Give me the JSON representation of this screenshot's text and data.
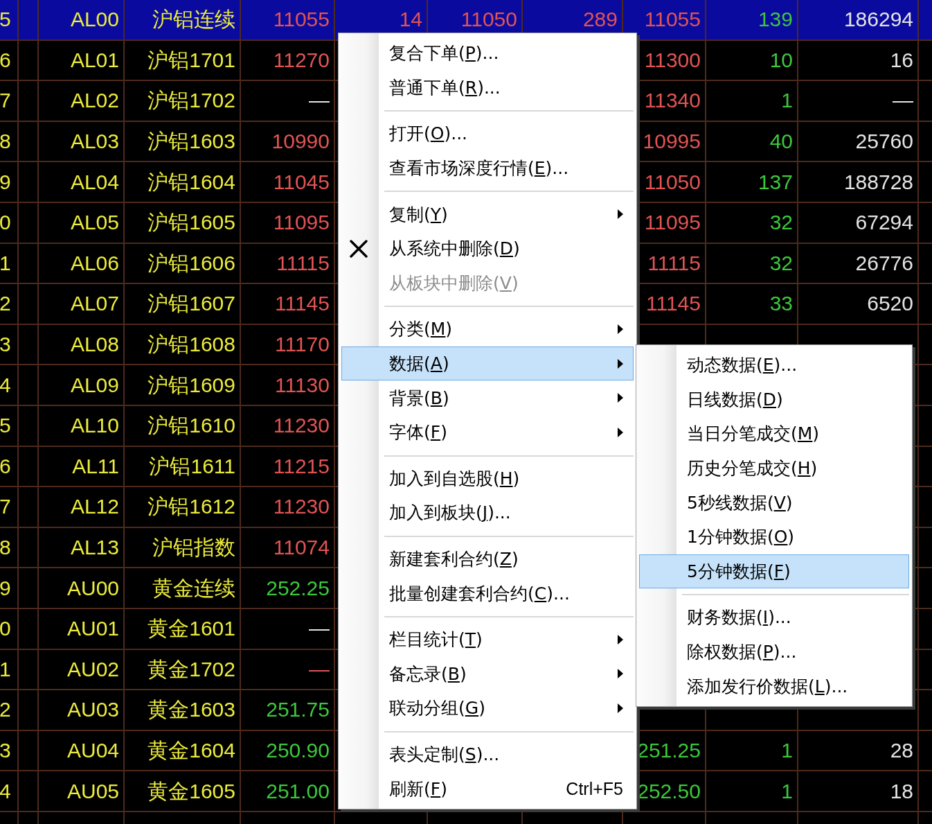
{
  "table": {
    "rows": [
      {
        "selected": true,
        "column_1": {
          "text": "5",
          "kind": "label"
        },
        "column_3": {
          "text": "AL00",
          "kind": "label"
        },
        "column_4": {
          "text": "沪铝连续",
          "kind": "label"
        },
        "column_5": {
          "text": "11055",
          "kind": "up"
        },
        "column_6": {
          "text": "14",
          "kind": "up"
        },
        "column_7": {
          "text": "11050",
          "kind": "up"
        },
        "column_8": {
          "text": "289",
          "kind": "up"
        },
        "column_9": {
          "text": "11055",
          "kind": "up"
        },
        "column_10": {
          "text": "139",
          "kind": "down"
        },
        "column_11": {
          "text": "186294",
          "kind": "flat"
        }
      },
      {
        "selected": false,
        "column_1": {
          "text": "6",
          "kind": "label"
        },
        "column_3": {
          "text": "AL01",
          "kind": "label"
        },
        "column_4": {
          "text": "沪铝1701",
          "kind": "label"
        },
        "column_5": {
          "text": "11270",
          "kind": "up"
        },
        "column_9": {
          "text": "11300",
          "kind": "up"
        },
        "column_10": {
          "text": "10",
          "kind": "down"
        },
        "column_11": {
          "text": "16",
          "kind": "flat"
        }
      },
      {
        "selected": false,
        "column_1": {
          "text": "7",
          "kind": "label"
        },
        "column_3": {
          "text": "AL02",
          "kind": "label"
        },
        "column_4": {
          "text": "沪铝1702",
          "kind": "label"
        },
        "column_5": {
          "text": "—",
          "kind": "flat"
        },
        "column_9": {
          "text": "11340",
          "kind": "up"
        },
        "column_10": {
          "text": "1",
          "kind": "down"
        },
        "column_11": {
          "text": "—",
          "kind": "flat"
        }
      },
      {
        "selected": false,
        "column_1": {
          "text": "8",
          "kind": "label"
        },
        "column_3": {
          "text": "AL03",
          "kind": "label"
        },
        "column_4": {
          "text": "沪铝1603",
          "kind": "label"
        },
        "column_5": {
          "text": "10990",
          "kind": "up"
        },
        "column_9": {
          "text": "10995",
          "kind": "up"
        },
        "column_10": {
          "text": "40",
          "kind": "down"
        },
        "column_11": {
          "text": "25760",
          "kind": "flat"
        }
      },
      {
        "selected": false,
        "column_1": {
          "text": "9",
          "kind": "label"
        },
        "column_3": {
          "text": "AL04",
          "kind": "label"
        },
        "column_4": {
          "text": "沪铝1604",
          "kind": "label"
        },
        "column_5": {
          "text": "11045",
          "kind": "up"
        },
        "column_9": {
          "text": "11050",
          "kind": "up"
        },
        "column_10": {
          "text": "137",
          "kind": "down"
        },
        "column_11": {
          "text": "188728",
          "kind": "flat"
        }
      },
      {
        "selected": false,
        "column_1": {
          "text": "0",
          "kind": "label"
        },
        "column_3": {
          "text": "AL05",
          "kind": "label"
        },
        "column_4": {
          "text": "沪铝1605",
          "kind": "label"
        },
        "column_5": {
          "text": "11095",
          "kind": "up"
        },
        "column_9": {
          "text": "11095",
          "kind": "up"
        },
        "column_10": {
          "text": "32",
          "kind": "down"
        },
        "column_11": {
          "text": "67294",
          "kind": "flat"
        }
      },
      {
        "selected": false,
        "column_1": {
          "text": "1",
          "kind": "label"
        },
        "column_3": {
          "text": "AL06",
          "kind": "label"
        },
        "column_4": {
          "text": "沪铝1606",
          "kind": "label"
        },
        "column_5": {
          "text": "11115",
          "kind": "up"
        },
        "column_9": {
          "text": "11115",
          "kind": "up"
        },
        "column_10": {
          "text": "32",
          "kind": "down"
        },
        "column_11": {
          "text": "26776",
          "kind": "flat"
        }
      },
      {
        "selected": false,
        "column_1": {
          "text": "2",
          "kind": "label"
        },
        "column_3": {
          "text": "AL07",
          "kind": "label"
        },
        "column_4": {
          "text": "沪铝1607",
          "kind": "label"
        },
        "column_5": {
          "text": "11145",
          "kind": "up"
        },
        "column_9": {
          "text": "11145",
          "kind": "up"
        },
        "column_10": {
          "text": "33",
          "kind": "down"
        },
        "column_11": {
          "text": "6520",
          "kind": "flat"
        }
      },
      {
        "selected": false,
        "column_1": {
          "text": "3",
          "kind": "label"
        },
        "column_3": {
          "text": "AL08",
          "kind": "label"
        },
        "column_4": {
          "text": "沪铝1608",
          "kind": "label"
        },
        "column_5": {
          "text": "11170",
          "kind": "up"
        }
      },
      {
        "selected": false,
        "column_1": {
          "text": "4",
          "kind": "label"
        },
        "column_3": {
          "text": "AL09",
          "kind": "label"
        },
        "column_4": {
          "text": "沪铝1609",
          "kind": "label"
        },
        "column_5": {
          "text": "11130",
          "kind": "up"
        }
      },
      {
        "selected": false,
        "column_1": {
          "text": "5",
          "kind": "label"
        },
        "column_3": {
          "text": "AL10",
          "kind": "label"
        },
        "column_4": {
          "text": "沪铝1610",
          "kind": "label"
        },
        "column_5": {
          "text": "11230",
          "kind": "up"
        }
      },
      {
        "selected": false,
        "column_1": {
          "text": "6",
          "kind": "label"
        },
        "column_3": {
          "text": "AL11",
          "kind": "label"
        },
        "column_4": {
          "text": "沪铝1611",
          "kind": "label"
        },
        "column_5": {
          "text": "11215",
          "kind": "up"
        }
      },
      {
        "selected": false,
        "column_1": {
          "text": "7",
          "kind": "label"
        },
        "column_3": {
          "text": "AL12",
          "kind": "label"
        },
        "column_4": {
          "text": "沪铝1612",
          "kind": "label"
        },
        "column_5": {
          "text": "11230",
          "kind": "up"
        }
      },
      {
        "selected": false,
        "column_1": {
          "text": "8",
          "kind": "label"
        },
        "column_3": {
          "text": "AL13",
          "kind": "label"
        },
        "column_4": {
          "text": "沪铝指数",
          "kind": "label"
        },
        "column_5": {
          "text": "11074",
          "kind": "up"
        }
      },
      {
        "selected": false,
        "column_1": {
          "text": "9",
          "kind": "label"
        },
        "column_3": {
          "text": "AU00",
          "kind": "label"
        },
        "column_4": {
          "text": "黄金连续",
          "kind": "label"
        },
        "column_5": {
          "text": "252.25",
          "kind": "down"
        }
      },
      {
        "selected": false,
        "column_1": {
          "text": "0",
          "kind": "label"
        },
        "column_3": {
          "text": "AU01",
          "kind": "label"
        },
        "column_4": {
          "text": "黄金1601",
          "kind": "label"
        },
        "column_5": {
          "text": "—",
          "kind": "flat"
        }
      },
      {
        "selected": false,
        "column_1": {
          "text": "1",
          "kind": "label"
        },
        "column_3": {
          "text": "AU02",
          "kind": "label"
        },
        "column_4": {
          "text": "黄金1702",
          "kind": "label"
        },
        "column_5": {
          "text": "—",
          "kind": "up"
        }
      },
      {
        "selected": false,
        "column_1": {
          "text": "2",
          "kind": "label"
        },
        "column_3": {
          "text": "AU03",
          "kind": "label"
        },
        "column_4": {
          "text": "黄金1603",
          "kind": "label"
        },
        "column_5": {
          "text": "251.75",
          "kind": "down"
        }
      },
      {
        "selected": false,
        "column_1": {
          "text": "3",
          "kind": "label"
        },
        "column_3": {
          "text": "AU04",
          "kind": "label"
        },
        "column_4": {
          "text": "黄金1604",
          "kind": "label"
        },
        "column_5": {
          "text": "250.90",
          "kind": "down"
        },
        "column_9": {
          "text": "251.25",
          "kind": "down"
        },
        "column_10": {
          "text": "1",
          "kind": "down"
        },
        "column_11": {
          "text": "28",
          "kind": "flat"
        }
      },
      {
        "selected": false,
        "column_1": {
          "text": "4",
          "kind": "label"
        },
        "column_3": {
          "text": "AU05",
          "kind": "label"
        },
        "column_4": {
          "text": "黄金1605",
          "kind": "label"
        },
        "column_5": {
          "text": "251.00",
          "kind": "down"
        },
        "column_9": {
          "text": "252.50",
          "kind": "down"
        },
        "column_10": {
          "text": "1",
          "kind": "down"
        },
        "column_11": {
          "text": "18",
          "kind": "flat"
        }
      }
    ]
  },
  "context_menu": {
    "items": [
      {
        "kind": "item",
        "text": "复合下单(",
        "key": "P",
        "rest": ")...",
        "submenu": false,
        "disabled": false,
        "selected": false
      },
      {
        "kind": "item",
        "text": "普通下单(",
        "key": "R",
        "rest": ")...",
        "submenu": false,
        "disabled": false,
        "selected": false
      },
      {
        "kind": "separator"
      },
      {
        "kind": "item",
        "text": "打开(",
        "key": "O",
        "rest": ")...",
        "submenu": false,
        "disabled": false,
        "selected": false
      },
      {
        "kind": "item",
        "text": "查看市场深度行情(",
        "key": "E",
        "rest": ")...",
        "submenu": false,
        "disabled": false,
        "selected": false
      },
      {
        "kind": "separator"
      },
      {
        "kind": "item",
        "text": "复制(",
        "key": "Y",
        "rest": ")",
        "submenu": true,
        "disabled": false,
        "selected": false
      },
      {
        "kind": "delete",
        "text": "从系统中删除(",
        "key": "D",
        "rest": ")",
        "submenu": false,
        "disabled": false,
        "selected": false
      },
      {
        "kind": "item",
        "text": "从板块中删除(",
        "key": "V",
        "rest": ")",
        "submenu": false,
        "disabled": true,
        "selected": false
      },
      {
        "kind": "separator"
      },
      {
        "kind": "item",
        "text": "分类(",
        "key": "M",
        "rest": ")",
        "submenu": true,
        "disabled": false,
        "selected": false
      },
      {
        "kind": "item",
        "text": "数据(",
        "key": "A",
        "rest": ")",
        "submenu": true,
        "disabled": false,
        "selected": true
      },
      {
        "kind": "item",
        "text": "背景(",
        "key": "B",
        "rest": ")",
        "submenu": true,
        "disabled": false,
        "selected": false
      },
      {
        "kind": "item",
        "text": "字体(",
        "key": "F",
        "rest": ")",
        "submenu": true,
        "disabled": false,
        "selected": false
      },
      {
        "kind": "separator"
      },
      {
        "kind": "item",
        "text": "加入到自选股(",
        "key": "H",
        "rest": ")",
        "submenu": false,
        "disabled": false,
        "selected": false
      },
      {
        "kind": "item",
        "text": "加入到板块(",
        "key": "J",
        "rest": ")...",
        "submenu": false,
        "disabled": false,
        "selected": false
      },
      {
        "kind": "separator"
      },
      {
        "kind": "item",
        "text": "新建套利合约(",
        "key": "Z",
        "rest": ")",
        "submenu": false,
        "disabled": false,
        "selected": false
      },
      {
        "kind": "item",
        "text": "批量创建套利合约(",
        "key": "C",
        "rest": ")...",
        "submenu": false,
        "disabled": false,
        "selected": false
      },
      {
        "kind": "separator"
      },
      {
        "kind": "item",
        "text": "栏目统计(",
        "key": "T",
        "rest": ")",
        "submenu": true,
        "disabled": false,
        "selected": false
      },
      {
        "kind": "item",
        "text": "备忘录(",
        "key": "B",
        "rest": ")",
        "submenu": true,
        "disabled": false,
        "selected": false
      },
      {
        "kind": "item",
        "text": "联动分组(",
        "key": "G",
        "rest": ")",
        "submenu": true,
        "disabled": false,
        "selected": false
      },
      {
        "kind": "separator"
      },
      {
        "kind": "item",
        "text": "表头定制(",
        "key": "S",
        "rest": ")...",
        "submenu": false,
        "disabled": false,
        "selected": false
      },
      {
        "kind": "item",
        "text": "刷新(",
        "key": "F",
        "rest": ")",
        "shortcut": "Ctrl+F5",
        "submenu": false,
        "disabled": false,
        "selected": false
      }
    ]
  },
  "submenu": {
    "items": [
      {
        "kind": "item",
        "text": "动态数据(",
        "key": "E",
        "rest": ")...",
        "selected": false
      },
      {
        "kind": "item",
        "text": "日线数据(",
        "key": "D",
        "rest": ")",
        "selected": false
      },
      {
        "kind": "item",
        "text": "当日分笔成交(",
        "key": "M",
        "rest": ")",
        "selected": false
      },
      {
        "kind": "item",
        "text": "历史分笔成交(",
        "key": "H",
        "rest": ")",
        "selected": false
      },
      {
        "kind": "item",
        "text": "5秒线数据(",
        "key": "V",
        "rest": ")",
        "selected": false
      },
      {
        "kind": "item",
        "text": "1分钟数据(",
        "key": "O",
        "rest": ")",
        "selected": false
      },
      {
        "kind": "item",
        "text": "5分钟数据(",
        "key": "F",
        "rest": ")",
        "selected": true
      },
      {
        "kind": "separator"
      },
      {
        "kind": "item",
        "text": "财务数据(",
        "key": "I",
        "rest": ")...",
        "selected": false
      },
      {
        "kind": "item",
        "text": "除权数据(",
        "key": "P",
        "rest": ")...",
        "selected": false
      },
      {
        "kind": "item",
        "text": "添加发行价数据(",
        "key": "L",
        "rest": ")...",
        "selected": false
      }
    ]
  }
}
